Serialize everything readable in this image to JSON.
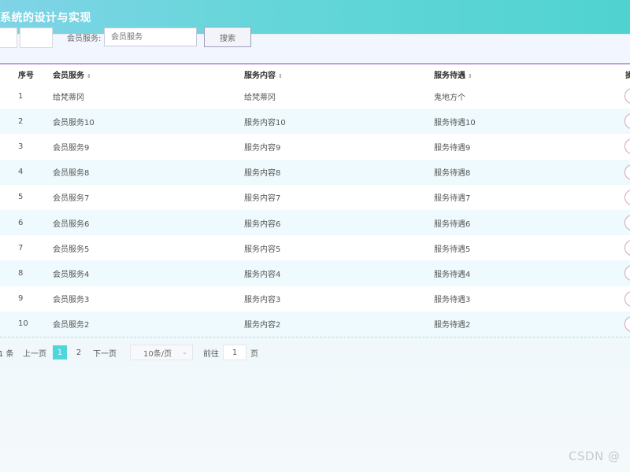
{
  "header": {
    "title": "系统的设计与实现"
  },
  "toolbar": {
    "btn1_label": "",
    "btn2_label": "",
    "filter_label": "会员服务:",
    "filter_placeholder": "会员服务",
    "filter_value": "",
    "search_label": "搜索"
  },
  "table": {
    "columns": [
      "序号",
      "会员服务",
      "服务内容",
      "服务待遇",
      "操"
    ],
    "rows": [
      [
        "1",
        "给梵蒂冈",
        "给梵蒂冈",
        "鬼地方个"
      ],
      [
        "2",
        "会员服务10",
        "服务内容10",
        "服务待遇10"
      ],
      [
        "3",
        "会员服务9",
        "服务内容9",
        "服务待遇9"
      ],
      [
        "4",
        "会员服务8",
        "服务内容8",
        "服务待遇8"
      ],
      [
        "5",
        "会员服务7",
        "服务内容7",
        "服务待遇7"
      ],
      [
        "6",
        "会员服务6",
        "服务内容6",
        "服务待遇6"
      ],
      [
        "7",
        "会员服务5",
        "服务内容5",
        "服务待遇5"
      ],
      [
        "8",
        "会员服务4",
        "服务内容4",
        "服务待遇4"
      ],
      [
        "9",
        "会员服务3",
        "服务内容3",
        "服务待遇3"
      ],
      [
        "10",
        "会员服务2",
        "服务内容2",
        "服务待遇2"
      ]
    ]
  },
  "pagination": {
    "total_text": "1 条",
    "prev_label": "上一页",
    "pages": [
      "1",
      "2"
    ],
    "current_page": "1",
    "next_label": "下一页",
    "page_size": "10条/页",
    "goto_label": "前往",
    "goto_value": "1",
    "page_unit": "页"
  },
  "watermark": "CSDN @",
  "colors": {
    "accent": "#4fd6dc",
    "header_gradient_start": "#7fd4e6",
    "header_gradient_end": "#4fd3d0",
    "table_border": "#c79fd6",
    "row_alt": "#eefafd"
  }
}
